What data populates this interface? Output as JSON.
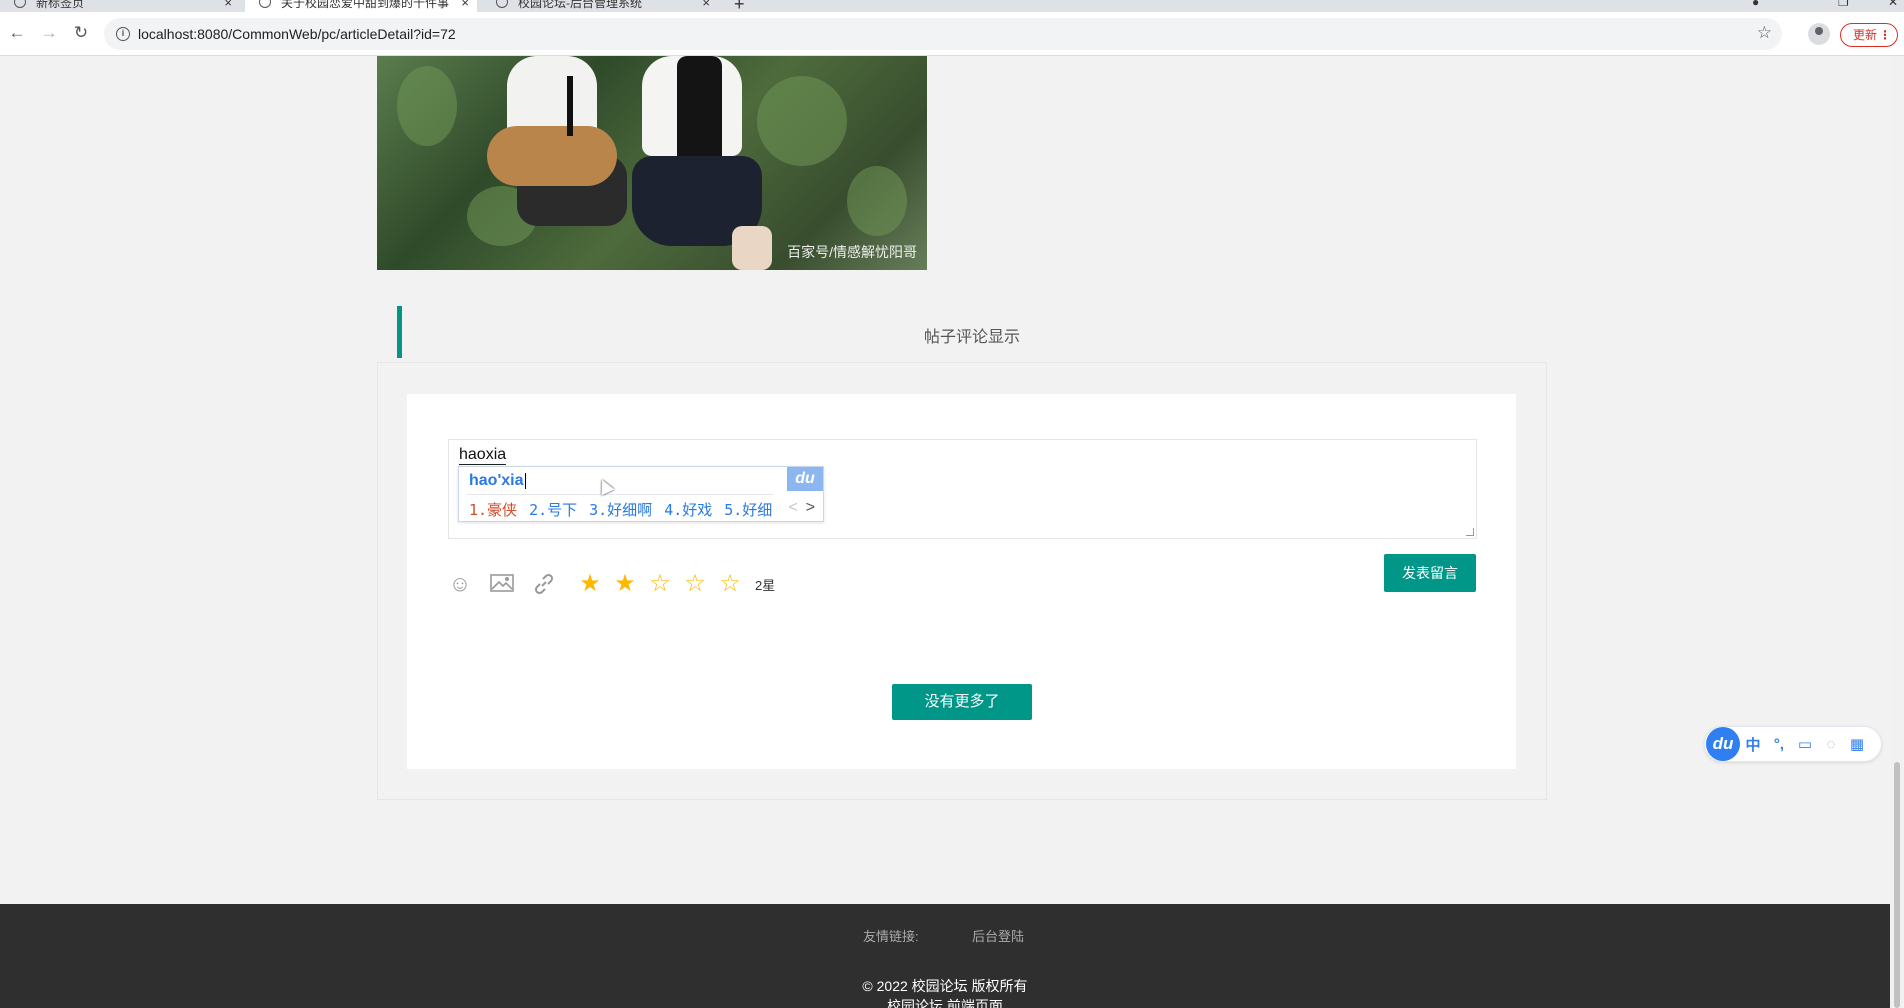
{
  "browser": {
    "tabs": [
      {
        "label": "新标签页",
        "active": false
      },
      {
        "label": "关于校园恋爱中甜到爆的十件事",
        "active": true
      },
      {
        "label": "校园论坛-后台管理系统",
        "active": false
      }
    ],
    "new_tab_symbol": "+",
    "close_symbol": "×",
    "url": "localhost:8080/CommonWeb/pc/articleDetail?id=72",
    "update_label": "更新"
  },
  "article": {
    "image_watermark": "百家号/情感解忧阳哥"
  },
  "comments": {
    "section_title": "帖子评论显示",
    "input_value": "haoxia",
    "publish_label": "发表留言",
    "rating": 2,
    "rating_max": 5,
    "rating_text": "2星",
    "no_more_label": "没有更多了",
    "toolbar_icons": [
      "smiley-icon",
      "image-icon",
      "link-icon"
    ]
  },
  "ime": {
    "pinyin": "hao'xia",
    "logo": "du",
    "candidates": [
      "1.豪侠",
      "2.号下",
      "3.好细啊",
      "4.好戏",
      "5.好细"
    ],
    "toolbar": {
      "logo": "du",
      "lang": "中",
      "punct": "°,",
      "items": [
        "keyboard-icon",
        "user-icon",
        "grid-icon"
      ]
    }
  },
  "footer": {
    "links_label": "友情链接:",
    "admin_link": "后台登陆",
    "copyright": "© 2022 校园论坛 版权所有",
    "front_label": "校园论坛 前端页面"
  },
  "colors": {
    "accent": "#009688",
    "star": "#ffb800",
    "footer_bg": "#2f2f2f"
  }
}
